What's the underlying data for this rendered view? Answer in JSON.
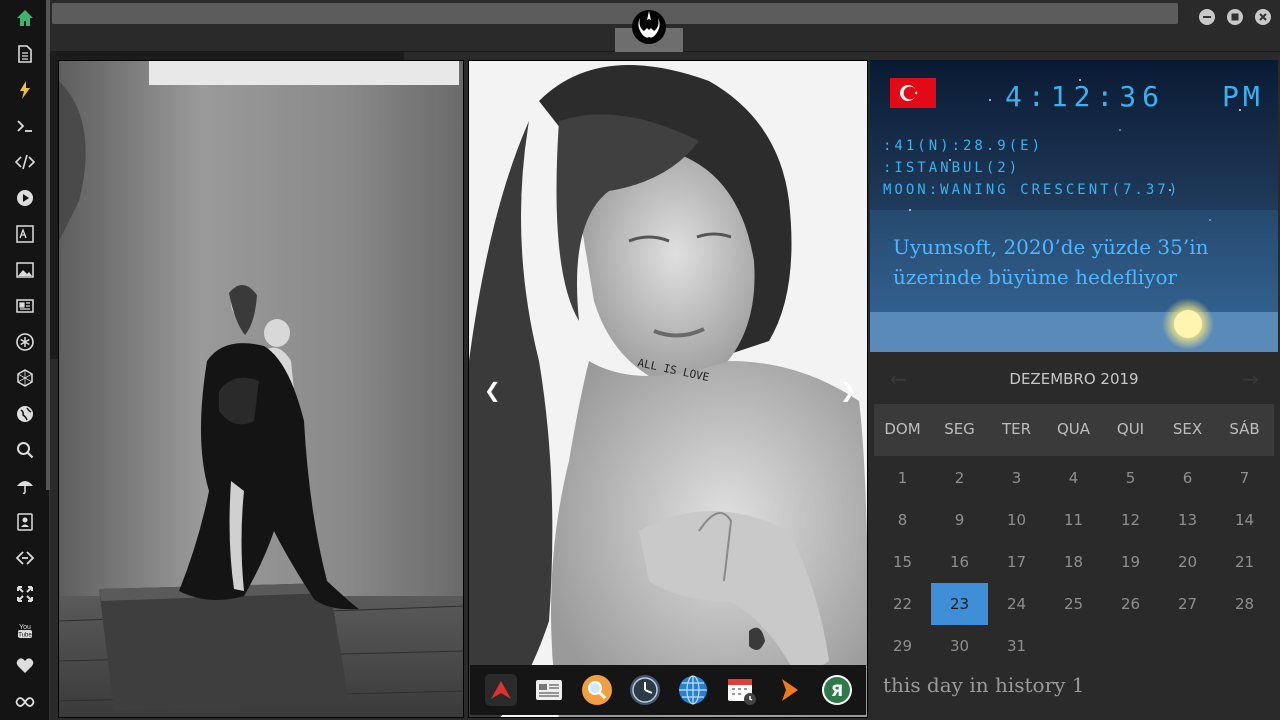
{
  "sidebar": {
    "items": [
      {
        "icon": "home-icon"
      },
      {
        "icon": "document-icon"
      },
      {
        "icon": "lightning-icon"
      },
      {
        "icon": "terminal-icon"
      },
      {
        "icon": "code-icon"
      },
      {
        "icon": "play-icon"
      },
      {
        "icon": "translate-icon"
      },
      {
        "icon": "image-icon"
      },
      {
        "icon": "newspaper-icon"
      },
      {
        "icon": "asterisk-icon"
      },
      {
        "icon": "hexagon-icon"
      },
      {
        "icon": "globe-icon"
      },
      {
        "icon": "search-icon"
      },
      {
        "icon": "umbrella-icon"
      },
      {
        "icon": "contact-icon"
      },
      {
        "icon": "link-icon"
      },
      {
        "icon": "expand-icon"
      },
      {
        "icon": "youtube-icon"
      },
      {
        "icon": "heart-icon"
      },
      {
        "icon": "infinity-icon"
      }
    ]
  },
  "gallery": {
    "prev_arrow": "❮",
    "next_arrow": "❯",
    "tattoo_text": "ALL IS LOVE"
  },
  "dock": {
    "icons": [
      "arrow-app-icon",
      "news-app-icon",
      "search-app-icon",
      "clock-app-icon",
      "globe-app-icon",
      "calendar-app-icon",
      "play-app-icon",
      "yandex-app-icon"
    ],
    "yandex_letter": "Я"
  },
  "clock_widget": {
    "flag_country": "Turkey",
    "time": "4:12:36",
    "ampm": "PM",
    "coords": ":41(N):28.9(E)",
    "city": ":ISTANBUL(2)",
    "moon": "MOON:WANING CRESCENT(7.37)",
    "headline": "Uyumsoft, 2020’de yüzde 35’in üzerinde büyüme hedefliyor"
  },
  "calendar": {
    "title": "DEZEMBRO 2019",
    "prev": "←",
    "next": "→",
    "weekdays": [
      "DOM",
      "SEG",
      "TER",
      "QUA",
      "QUI",
      "SEX",
      "SÁB"
    ],
    "weeks": [
      [
        "1",
        "2",
        "3",
        "4",
        "5",
        "6",
        "7"
      ],
      [
        "8",
        "9",
        "10",
        "11",
        "12",
        "13",
        "14"
      ],
      [
        "15",
        "16",
        "17",
        "18",
        "19",
        "20",
        "21"
      ],
      [
        "22",
        "23",
        "24",
        "25",
        "26",
        "27",
        "28"
      ],
      [
        "29",
        "30",
        "31",
        "",
        "",
        "",
        ""
      ]
    ],
    "selected": "23"
  },
  "history": {
    "text": "this day in history 1"
  },
  "colors": {
    "accent": "#3ab2f0",
    "selected_day": "#3f8fd8",
    "home_icon": "#3cb371"
  }
}
